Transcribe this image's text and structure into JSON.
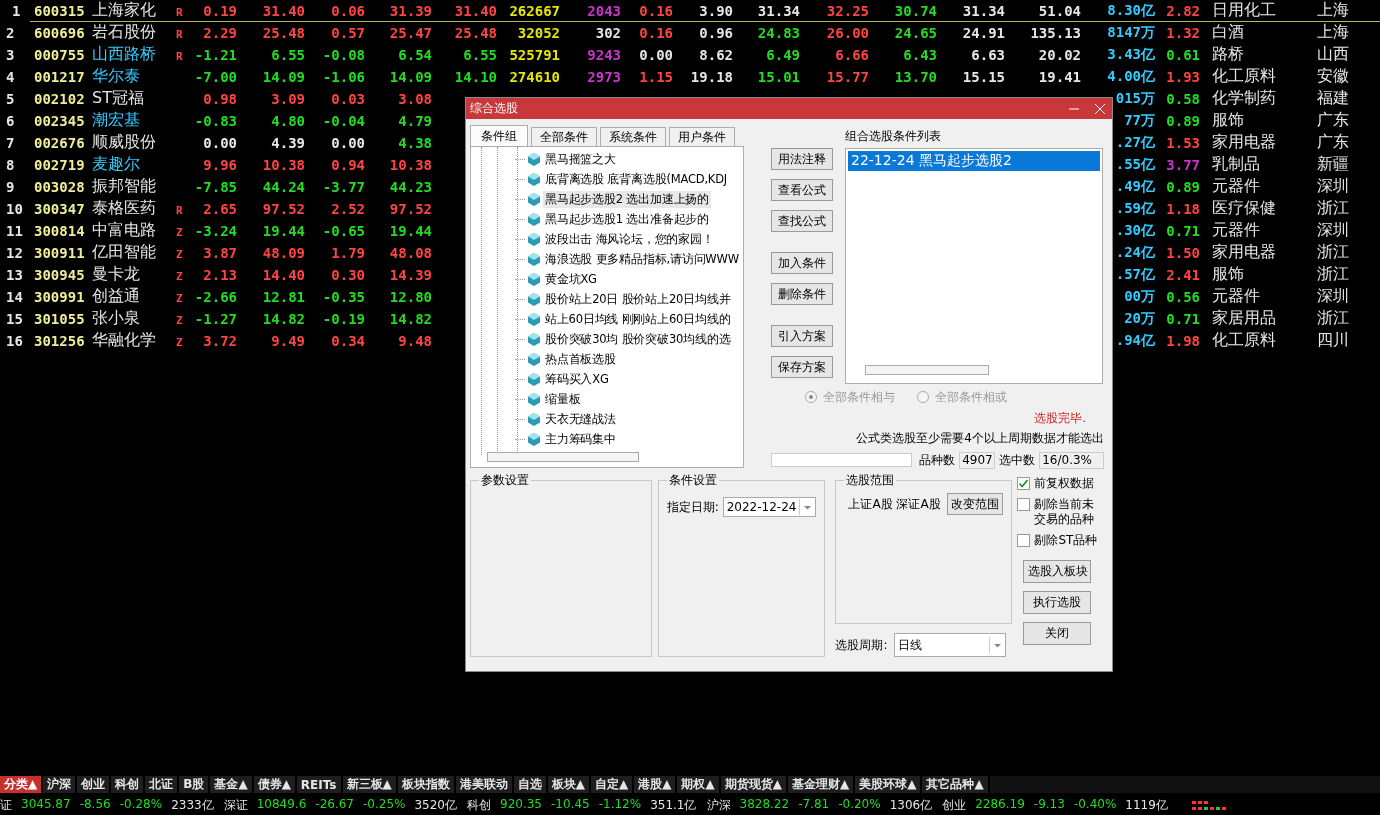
{
  "table": {
    "rows": [
      {
        "no": "1",
        "code": "600315",
        "name": {
          "text": "上海家化",
          "color": "#e6e6e6"
        },
        "flag": "R",
        "selected": true,
        "cells": [
          {
            "text": "0.19",
            "color": "#ff4444"
          },
          {
            "text": "31.40",
            "color": "#ff4444"
          },
          {
            "text": "0.06",
            "color": "#ff4444"
          },
          {
            "text": "31.39",
            "color": "#ff4444"
          },
          {
            "text": "31.40",
            "color": "#ff4444"
          },
          {
            "text": "262667",
            "color": "#e6e600"
          },
          {
            "text": "2043",
            "color": "#cc33cc"
          },
          {
            "text": "0.16",
            "color": "#ff4444"
          },
          {
            "text": "3.90",
            "color": "#e6e6e6"
          },
          {
            "text": "31.34",
            "color": "#e6e6e6"
          },
          {
            "text": "32.25",
            "color": "#ff4444"
          },
          {
            "text": "30.74",
            "color": "#22dd22"
          },
          {
            "text": "31.34",
            "color": "#e6e6e6"
          },
          {
            "text": "51.04",
            "color": "#e6e6e6"
          }
        ],
        "tail": [
          {
            "text": "8.30亿",
            "color": "#33ccff"
          },
          {
            "text": "2.82",
            "color": "#ff4444"
          },
          {
            "text": "日用化工",
            "color": "#e6e6e6"
          },
          {
            "text": "上海",
            "color": "#e6e6e6"
          }
        ]
      },
      {
        "no": "2",
        "code": "600696",
        "name": {
          "text": "岩石股份",
          "color": "#e6e6e6"
        },
        "flag": "R",
        "selected": false,
        "cells": [
          {
            "text": "2.29",
            "color": "#ff4444"
          },
          {
            "text": "25.48",
            "color": "#ff4444"
          },
          {
            "text": "0.57",
            "color": "#ff4444"
          },
          {
            "text": "25.47",
            "color": "#ff4444"
          },
          {
            "text": "25.48",
            "color": "#ff4444"
          },
          {
            "text": "32052",
            "color": "#e6e600"
          },
          {
            "text": "302",
            "color": "#e6e6e6"
          },
          {
            "text": "0.16",
            "color": "#ff4444"
          },
          {
            "text": "0.96",
            "color": "#e6e6e6"
          },
          {
            "text": "24.83",
            "color": "#22dd22"
          },
          {
            "text": "26.00",
            "color": "#ff4444"
          },
          {
            "text": "24.65",
            "color": "#22dd22"
          },
          {
            "text": "24.91",
            "color": "#e6e6e6"
          },
          {
            "text": "135.13",
            "color": "#e6e6e6"
          }
        ],
        "tail": [
          {
            "text": "8147万",
            "color": "#33ccff"
          },
          {
            "text": "1.32",
            "color": "#ff4444"
          },
          {
            "text": "白酒",
            "color": "#e6e6e6"
          },
          {
            "text": "上海",
            "color": "#e6e6e6"
          }
        ]
      },
      {
        "no": "3",
        "code": "000755",
        "name": {
          "text": "山西路桥",
          "color": "#33ccff"
        },
        "flag": "R",
        "selected": false,
        "cells": [
          {
            "text": "-1.21",
            "color": "#22dd22"
          },
          {
            "text": "6.55",
            "color": "#22dd22"
          },
          {
            "text": "-0.08",
            "color": "#22dd22"
          },
          {
            "text": "6.54",
            "color": "#22dd22"
          },
          {
            "text": "6.55",
            "color": "#22dd22"
          },
          {
            "text": "525791",
            "color": "#e6e600"
          },
          {
            "text": "9243",
            "color": "#cc33cc"
          },
          {
            "text": "0.00",
            "color": "#e6e6e6"
          },
          {
            "text": "8.62",
            "color": "#e6e6e6"
          },
          {
            "text": "6.49",
            "color": "#22dd22"
          },
          {
            "text": "6.66",
            "color": "#ff4444"
          },
          {
            "text": "6.43",
            "color": "#22dd22"
          },
          {
            "text": "6.63",
            "color": "#e6e6e6"
          },
          {
            "text": "20.02",
            "color": "#e6e6e6"
          }
        ],
        "tail": [
          {
            "text": "3.43亿",
            "color": "#33ccff"
          },
          {
            "text": "0.61",
            "color": "#22dd22"
          },
          {
            "text": "路桥",
            "color": "#e6e6e6"
          },
          {
            "text": "山西",
            "color": "#e6e6e6"
          }
        ]
      },
      {
        "no": "4",
        "code": "001217",
        "name": {
          "text": "华尔泰",
          "color": "#33ccff"
        },
        "selected": false,
        "cells": [
          {
            "text": "-7.00",
            "color": "#22dd22"
          },
          {
            "text": "14.09",
            "color": "#22dd22"
          },
          {
            "text": "-1.06",
            "color": "#22dd22"
          },
          {
            "text": "14.09",
            "color": "#22dd22"
          },
          {
            "text": "14.10",
            "color": "#22dd22"
          },
          {
            "text": "274610",
            "color": "#e6e600"
          },
          {
            "text": "2973",
            "color": "#cc33cc"
          },
          {
            "text": "1.15",
            "color": "#ff4444"
          },
          {
            "text": "19.18",
            "color": "#e6e6e6"
          },
          {
            "text": "15.01",
            "color": "#22dd22"
          },
          {
            "text": "15.77",
            "color": "#ff4444"
          },
          {
            "text": "13.70",
            "color": "#22dd22"
          },
          {
            "text": "15.15",
            "color": "#e6e6e6"
          },
          {
            "text": "19.41",
            "color": "#e6e6e6"
          }
        ],
        "tail": [
          {
            "text": "4.00亿",
            "color": "#33ccff"
          },
          {
            "text": "1.93",
            "color": "#ff4444"
          },
          {
            "text": "化工原料",
            "color": "#e6e6e6"
          },
          {
            "text": "安徽",
            "color": "#e6e6e6"
          }
        ]
      },
      {
        "no": "5",
        "code": "002102",
        "name": {
          "text": "ST冠福",
          "color": "#e6e6e6"
        },
        "selected": false,
        "cells": [
          {
            "text": "0.98",
            "color": "#ff4444"
          },
          {
            "text": "3.09",
            "color": "#ff4444"
          },
          {
            "text": "0.03",
            "color": "#ff4444"
          },
          {
            "text": "3.08",
            "color": "#ff4444"
          }
        ],
        "tail": [
          {
            "text": "015万",
            "color": "#33ccff"
          },
          {
            "text": "0.58",
            "color": "#22dd22"
          },
          {
            "text": "化学制药",
            "color": "#e6e6e6"
          },
          {
            "text": "福建",
            "color": "#e6e6e6"
          }
        ]
      },
      {
        "no": "6",
        "code": "002345",
        "name": {
          "text": "潮宏基",
          "color": "#33ccff"
        },
        "selected": false,
        "cells": [
          {
            "text": "-0.83",
            "color": "#22dd22"
          },
          {
            "text": "4.80",
            "color": "#22dd22"
          },
          {
            "text": "-0.04",
            "color": "#22dd22"
          },
          {
            "text": "4.79",
            "color": "#22dd22"
          }
        ],
        "tail": [
          {
            "text": "77万",
            "color": "#33ccff"
          },
          {
            "text": "0.89",
            "color": "#22dd22"
          },
          {
            "text": "服饰",
            "color": "#e6e6e6"
          },
          {
            "text": "广东",
            "color": "#e6e6e6"
          }
        ]
      },
      {
        "no": "7",
        "code": "002676",
        "name": {
          "text": "顺威股份",
          "color": "#e6e6e6"
        },
        "selected": false,
        "cells": [
          {
            "text": "0.00",
            "color": "#e6e6e6"
          },
          {
            "text": "4.39",
            "color": "#e6e6e6"
          },
          {
            "text": "0.00",
            "color": "#e6e6e6"
          },
          {
            "text": "4.38",
            "color": "#22dd22"
          }
        ],
        "tail": [
          {
            "text": ".27亿",
            "color": "#33ccff"
          },
          {
            "text": "1.53",
            "color": "#ff4444"
          },
          {
            "text": "家用电器",
            "color": "#e6e6e6"
          },
          {
            "text": "广东",
            "color": "#e6e6e6"
          }
        ]
      },
      {
        "no": "8",
        "code": "002719",
        "name": {
          "text": "麦趣尔",
          "color": "#33ccff"
        },
        "selected": false,
        "cells": [
          {
            "text": "9.96",
            "color": "#ff4444"
          },
          {
            "text": "10.38",
            "color": "#ff4444"
          },
          {
            "text": "0.94",
            "color": "#ff4444"
          },
          {
            "text": "10.38",
            "color": "#ff4444"
          }
        ],
        "tail": [
          {
            "text": ".55亿",
            "color": "#33ccff"
          },
          {
            "text": "3.77",
            "color": "#cc33cc"
          },
          {
            "text": "乳制品",
            "color": "#e6e6e6"
          },
          {
            "text": "新疆",
            "color": "#e6e6e6"
          }
        ]
      },
      {
        "no": "9",
        "code": "003028",
        "name": {
          "text": "振邦智能",
          "color": "#e6e6e6"
        },
        "selected": false,
        "cells": [
          {
            "text": "-7.85",
            "color": "#22dd22"
          },
          {
            "text": "44.24",
            "color": "#22dd22"
          },
          {
            "text": "-3.77",
            "color": "#22dd22"
          },
          {
            "text": "44.23",
            "color": "#22dd22"
          }
        ],
        "tail": [
          {
            "text": ".49亿",
            "color": "#33ccff"
          },
          {
            "text": "0.89",
            "color": "#22dd22"
          },
          {
            "text": "元器件",
            "color": "#e6e6e6"
          },
          {
            "text": "深圳",
            "color": "#e6e6e6"
          }
        ]
      },
      {
        "no": "10",
        "code": "300347",
        "name": {
          "text": "泰格医药",
          "color": "#e6e6e6"
        },
        "flag": "R",
        "selected": false,
        "cells": [
          {
            "text": "2.65",
            "color": "#ff4444"
          },
          {
            "text": "97.52",
            "color": "#ff4444"
          },
          {
            "text": "2.52",
            "color": "#ff4444"
          },
          {
            "text": "97.52",
            "color": "#ff4444"
          }
        ],
        "tail": [
          {
            "text": ".59亿",
            "color": "#33ccff"
          },
          {
            "text": "1.18",
            "color": "#ff4444"
          },
          {
            "text": "医疗保健",
            "color": "#e6e6e6"
          },
          {
            "text": "浙江",
            "color": "#e6e6e6"
          }
        ]
      },
      {
        "no": "11",
        "code": "300814",
        "name": {
          "text": "中富电路",
          "color": "#e6e6e6"
        },
        "flag": "Z",
        "selected": false,
        "cells": [
          {
            "text": "-3.24",
            "color": "#22dd22"
          },
          {
            "text": "19.44",
            "color": "#22dd22"
          },
          {
            "text": "-0.65",
            "color": "#22dd22"
          },
          {
            "text": "19.44",
            "color": "#22dd22"
          }
        ],
        "tail": [
          {
            "text": ".30亿",
            "color": "#33ccff"
          },
          {
            "text": "0.71",
            "color": "#22dd22"
          },
          {
            "text": "元器件",
            "color": "#e6e6e6"
          },
          {
            "text": "深圳",
            "color": "#e6e6e6"
          }
        ]
      },
      {
        "no": "12",
        "code": "300911",
        "name": {
          "text": "亿田智能",
          "color": "#e6e6e6"
        },
        "flag": "Z",
        "selected": false,
        "cells": [
          {
            "text": "3.87",
            "color": "#ff4444"
          },
          {
            "text": "48.09",
            "color": "#ff4444"
          },
          {
            "text": "1.79",
            "color": "#ff4444"
          },
          {
            "text": "48.08",
            "color": "#ff4444"
          }
        ],
        "tail": [
          {
            "text": ".24亿",
            "color": "#33ccff"
          },
          {
            "text": "1.50",
            "color": "#ff4444"
          },
          {
            "text": "家用电器",
            "color": "#e6e6e6"
          },
          {
            "text": "浙江",
            "color": "#e6e6e6"
          }
        ]
      },
      {
        "no": "13",
        "code": "300945",
        "name": {
          "text": "曼卡龙",
          "color": "#e6e6e6"
        },
        "flag": "Z",
        "selected": false,
        "cells": [
          {
            "text": "2.13",
            "color": "#ff4444"
          },
          {
            "text": "14.40",
            "color": "#ff4444"
          },
          {
            "text": "0.30",
            "color": "#ff4444"
          },
          {
            "text": "14.39",
            "color": "#ff4444"
          }
        ],
        "tail": [
          {
            "text": ".57亿",
            "color": "#33ccff"
          },
          {
            "text": "2.41",
            "color": "#ff4444"
          },
          {
            "text": "服饰",
            "color": "#e6e6e6"
          },
          {
            "text": "浙江",
            "color": "#e6e6e6"
          }
        ]
      },
      {
        "no": "14",
        "code": "300991",
        "name": {
          "text": "创益通",
          "color": "#e6e6e6"
        },
        "flag": "Z",
        "selected": false,
        "cells": [
          {
            "text": "-2.66",
            "color": "#22dd22"
          },
          {
            "text": "12.81",
            "color": "#22dd22"
          },
          {
            "text": "-0.35",
            "color": "#22dd22"
          },
          {
            "text": "12.80",
            "color": "#22dd22"
          }
        ],
        "tail": [
          {
            "text": "00万",
            "color": "#33ccff"
          },
          {
            "text": "0.56",
            "color": "#22dd22"
          },
          {
            "text": "元器件",
            "color": "#e6e6e6"
          },
          {
            "text": "深圳",
            "color": "#e6e6e6"
          }
        ]
      },
      {
        "no": "15",
        "code": "301055",
        "name": {
          "text": "张小泉",
          "color": "#e6e6e6"
        },
        "flag": "Z",
        "selected": false,
        "cells": [
          {
            "text": "-1.27",
            "color": "#22dd22"
          },
          {
            "text": "14.82",
            "color": "#22dd22"
          },
          {
            "text": "-0.19",
            "color": "#22dd22"
          },
          {
            "text": "14.82",
            "color": "#22dd22"
          }
        ],
        "tail": [
          {
            "text": "20万",
            "color": "#33ccff"
          },
          {
            "text": "0.71",
            "color": "#22dd22"
          },
          {
            "text": "家居用品",
            "color": "#e6e6e6"
          },
          {
            "text": "浙江",
            "color": "#e6e6e6"
          }
        ]
      },
      {
        "no": "16",
        "code": "301256",
        "name": {
          "text": "华融化学",
          "color": "#e6e6e6"
        },
        "flag": "Z",
        "selected": false,
        "cells": [
          {
            "text": "3.72",
            "color": "#ff4444"
          },
          {
            "text": "9.49",
            "color": "#ff4444"
          },
          {
            "text": "0.34",
            "color": "#ff4444"
          },
          {
            "text": "9.48",
            "color": "#ff4444"
          }
        ],
        "tail": [
          {
            "text": ".94亿",
            "color": "#33ccff"
          },
          {
            "text": "1.98",
            "color": "#ff4444"
          },
          {
            "text": "化工原料",
            "color": "#e6e6e6"
          },
          {
            "text": "四川",
            "color": "#e6e6e6"
          }
        ]
      }
    ]
  },
  "dialog": {
    "title": "综合选股",
    "tabs": [
      {
        "label": "条件组",
        "selected": true
      },
      {
        "label": "全部条件",
        "selected": false
      },
      {
        "label": "系统条件",
        "selected": false
      },
      {
        "label": "用户条件",
        "selected": false
      }
    ],
    "tree_items": [
      {
        "label": "黑马摇篮之大",
        "selected": false
      },
      {
        "label": "底背离选股  底背离选股(MACD,KDJ",
        "selected": false
      },
      {
        "label": "黑马起步选股2 选出加速上扬的",
        "selected": true
      },
      {
        "label": "黑马起步选股1 选出准备起步的",
        "selected": false
      },
      {
        "label": "波段出击 海风论坛，您的家园！",
        "selected": false
      },
      {
        "label": "海浪选股 更多精品指标,请访问WWW",
        "selected": false
      },
      {
        "label": "黄金坑XG",
        "selected": false
      },
      {
        "label": "股价站上20日 股价站上20日均线并",
        "selected": false
      },
      {
        "label": "站上60日均线 刚刚站上60日均线的",
        "selected": false
      },
      {
        "label": "股价突破30均 股价突破30均线的选",
        "selected": false
      },
      {
        "label": "热点首板选股",
        "selected": false
      },
      {
        "label": "筹码买入XG",
        "selected": false
      },
      {
        "label": "缩量板",
        "selected": false
      },
      {
        "label": "天衣无缝战法",
        "selected": false
      },
      {
        "label": "主力筹码集中",
        "selected": false
      }
    ],
    "action_buttons": [
      [
        "用法注释",
        "查看公式",
        "查找公式"
      ],
      [
        "加入条件",
        "删除条件"
      ],
      [
        "引入方案",
        "保存方案"
      ]
    ],
    "list_label": "组合选股条件列表",
    "list_items": [
      {
        "label": "22-12-24 黑马起步选股2",
        "selected": true
      }
    ],
    "radios": [
      {
        "label": "全部条件相与",
        "selected": true,
        "disabled": true
      },
      {
        "label": "全部条件相或",
        "selected": false,
        "disabled": true
      }
    ],
    "status": "选股完毕.",
    "note": "公式类选股至少需要4个以上周期数据才能选出",
    "count_label": "品种数",
    "count_value": "4907",
    "picked_label": "选中数",
    "picked_value": "16/0.3%",
    "params_group": "参数设置",
    "condition_group": "条件设置",
    "date_label": "指定日期:",
    "date_value": "2022-12-24",
    "range_group": "选股范围",
    "range_text": "上证A股 深证A股",
    "range_button": "改变范围",
    "period_label": "选股周期:",
    "period_value": "日线",
    "checkboxes": [
      {
        "label": "前复权数据",
        "checked": true
      },
      {
        "label": "剔除当前未交易的品种",
        "checked": false
      },
      {
        "label": "剔除ST品种",
        "checked": false
      }
    ],
    "progress": {
      "level": 0
    },
    "bottom_buttons": [
      "选股入板块",
      "执行选股",
      "关闭"
    ]
  },
  "category_tabs": [
    {
      "label": "分类▲",
      "selected": true
    },
    {
      "label": "沪深",
      "selected": false
    },
    {
      "label": "创业",
      "selected": false
    },
    {
      "label": "科创",
      "selected": false
    },
    {
      "label": "北证",
      "selected": false
    },
    {
      "label": "B股",
      "selected": false
    },
    {
      "label": "基金▲",
      "selected": false
    },
    {
      "label": "债券▲",
      "selected": false
    },
    {
      "label": "REITs",
      "selected": false
    },
    {
      "label": "新三板▲",
      "selected": false
    },
    {
      "label": "板块指数",
      "selected": false
    },
    {
      "label": "港美联动",
      "selected": false
    },
    {
      "label": "自选",
      "selected": false
    },
    {
      "label": "板块▲",
      "selected": false
    },
    {
      "label": "自定▲",
      "selected": false
    },
    {
      "label": "港股▲",
      "selected": false
    },
    {
      "label": "期权▲",
      "selected": false
    },
    {
      "label": "期货现货▲",
      "selected": false
    },
    {
      "label": "基金理财▲",
      "selected": false
    },
    {
      "label": "美股环球▲",
      "selected": false
    },
    {
      "label": "其它品种▲",
      "selected": false
    }
  ],
  "ticker": [
    {
      "name": "证",
      "value": "3045.87",
      "change": "-8.56",
      "pct": "-0.28%",
      "amount": "2333亿",
      "color": "#22dd22"
    },
    {
      "name": "深证",
      "value": "10849.6",
      "change": "-26.67",
      "pct": "-0.25%",
      "amount": "3520亿",
      "color": "#22dd22"
    },
    {
      "name": "科创",
      "value": "920.35",
      "change": "-10.45",
      "pct": "-1.12%",
      "amount": "351.1亿",
      "color": "#22dd22"
    },
    {
      "name": "沪深",
      "value": "3828.22",
      "change": "-7.81",
      "pct": "-0.20%",
      "amount": "1306亿",
      "color": "#22dd22"
    },
    {
      "name": "创业",
      "value": "2286.19",
      "change": "-9.13",
      "pct": "-0.40%",
      "amount": "1119亿",
      "color": "#22dd22"
    }
  ]
}
